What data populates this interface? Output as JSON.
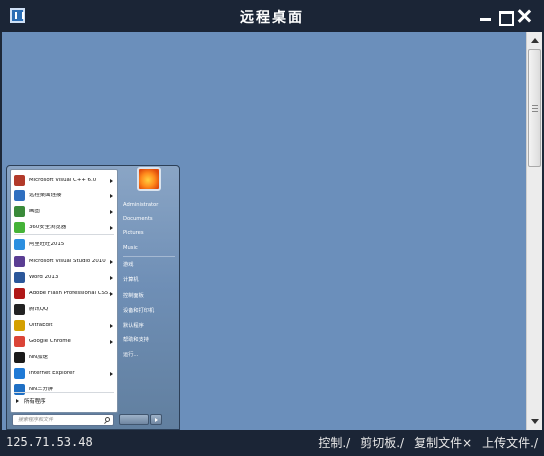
{
  "window": {
    "title": "远程桌面"
  },
  "status": {
    "ip": "125.71.53.48",
    "actions": [
      "控制./",
      "剪切板./",
      "复制文件×",
      "上传文件./"
    ]
  },
  "start_menu": {
    "programs": [
      {
        "label": "Microsoft Visual C++ 6.0",
        "icon": "visual-cpp-icon",
        "color": "#b23a2a",
        "submenu": true
      },
      {
        "label": "远程桌面连接",
        "icon": "remote-desktop-icon",
        "color": "#2f6fc0",
        "submenu": true
      },
      {
        "label": "画图",
        "icon": "paint-icon",
        "color": "#3a8a3a",
        "submenu": true
      },
      {
        "label": "360安全浏览器",
        "icon": "browser-360-icon",
        "color": "#45b338",
        "submenu": true
      },
      {
        "label": "阿里旺旺2015",
        "icon": "aliwangwang-icon",
        "color": "#2b8fe0",
        "submenu": false
      },
      {
        "label": "Microsoft Visual Studio 2010",
        "icon": "visual-studio-icon",
        "color": "#5a3d93",
        "submenu": true
      },
      {
        "label": "Word 2013",
        "icon": "word-icon",
        "color": "#2b579a",
        "submenu": true
      },
      {
        "label": "Adobe Flash Professional CS5.5",
        "icon": "flash-icon",
        "color": "#b01818",
        "submenu": true
      },
      {
        "label": "腾讯QQ",
        "icon": "qq-icon",
        "color": "#222222",
        "submenu": false
      },
      {
        "label": "UltraEdit",
        "icon": "ultraedit-icon",
        "color": "#d4a000",
        "submenu": true
      },
      {
        "label": "Google Chrome",
        "icon": "chrome-icon",
        "color": "#db4437",
        "submenu": true
      },
      {
        "label": "NN加速",
        "icon": "nn-accel-icon",
        "color": "#1a1a1a",
        "submenu": false
      },
      {
        "label": "Internet Explorer",
        "icon": "ie-icon",
        "color": "#1f7ad6",
        "submenu": true
      },
      {
        "label": "NN三分屏",
        "icon": "nn-split-icon",
        "color": "#1e6fc4",
        "submenu": false
      }
    ],
    "all_programs": "所有程序",
    "search_placeholder": "搜索程序和文件",
    "right_links": [
      "Administrator",
      "Documents",
      "Pictures",
      "Music",
      "游戏",
      "计算机",
      "控制面板",
      "设备和打印机",
      "默认程序",
      "帮助和支持",
      "运行..."
    ]
  }
}
